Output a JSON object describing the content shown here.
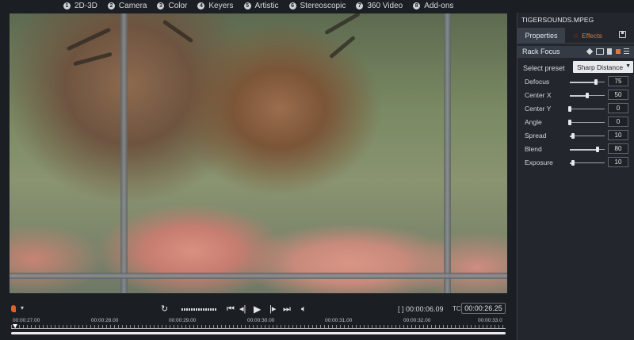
{
  "categories": [
    {
      "num": "1",
      "label": "2D-3D"
    },
    {
      "num": "2",
      "label": "Camera"
    },
    {
      "num": "3",
      "label": "Color"
    },
    {
      "num": "4",
      "label": "Keyers"
    },
    {
      "num": "5",
      "label": "Artistic"
    },
    {
      "num": "6",
      "label": "Stereoscopic"
    },
    {
      "num": "7",
      "label": "360 Video"
    },
    {
      "num": "8",
      "label": "Add-ons"
    }
  ],
  "transport": {
    "inout_label": "[ ]",
    "duration": "00:00:06.09",
    "tc_label": "TC",
    "timecode": "00:00:26.25",
    "dropdown_glyph": "▾"
  },
  "timeline": {
    "ticks": [
      "00:00:27.00",
      "00:00:28.00",
      "00:00:29.00",
      "00:00:30.00",
      "00:00:31.00",
      "00:00:32.00",
      "00:00:33.0"
    ]
  },
  "panel": {
    "file_title": "TIGERSOUNDS.MPEG",
    "tab_properties": "Properties",
    "tab_effects": "Effects",
    "effect_name": "Rack Focus",
    "preset_label": "Select preset",
    "preset_value": "Sharp Distance",
    "params": [
      {
        "label": "Defocus",
        "value": "75",
        "level": 0.75
      },
      {
        "label": "Center X",
        "value": "50",
        "level": 0.5
      },
      {
        "label": "Center Y",
        "value": "0",
        "level": 0.0
      },
      {
        "label": "Angle",
        "value": "0",
        "level": 0.0
      },
      {
        "label": "Spread",
        "value": "10",
        "level": 0.1
      },
      {
        "label": "Blend",
        "value": "80",
        "level": 0.8
      },
      {
        "label": "Exposure",
        "value": "10",
        "level": 0.1
      }
    ]
  },
  "icons": {
    "marker": "marker-icon",
    "loop": "loop-icon",
    "prev_edit": "skip-back-icon",
    "step_back": "step-back-icon",
    "play": "play-icon",
    "step_fwd": "step-forward-icon",
    "next_edit": "skip-forward-icon",
    "volume": "volume-icon",
    "save": "save-icon"
  },
  "colors": {
    "accent": "#e0762f",
    "background": "#1b1f24",
    "panel": "#23272d"
  }
}
